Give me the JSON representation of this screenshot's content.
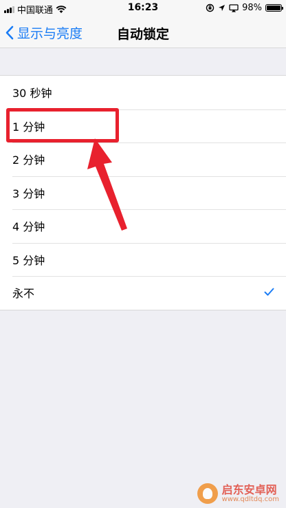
{
  "status_bar": {
    "carrier": "中国联通",
    "time": "16:23",
    "battery_percent": "98%",
    "battery_level": 0.98,
    "icons": [
      "signal-icon",
      "wifi-icon",
      "rotation-lock-icon",
      "location-icon",
      "airplay-icon",
      "battery-icon"
    ]
  },
  "nav": {
    "back_label": "显示与亮度",
    "title": "自动锁定"
  },
  "options": [
    {
      "label": "30 秒钟",
      "selected": false
    },
    {
      "label": "1 分钟",
      "selected": false
    },
    {
      "label": "2 分钟",
      "selected": false
    },
    {
      "label": "3 分钟",
      "selected": false
    },
    {
      "label": "4 分钟",
      "selected": false
    },
    {
      "label": "5 分钟",
      "selected": false
    },
    {
      "label": "永不",
      "selected": true
    }
  ],
  "annotation": {
    "color": "#e8212e",
    "highlighted_option": "1 分钟"
  },
  "watermark": {
    "name": "启东安卓网",
    "url": "www.qdltdq.com"
  },
  "colors": {
    "accent": "#1a7cf5",
    "background": "#efeff4"
  }
}
